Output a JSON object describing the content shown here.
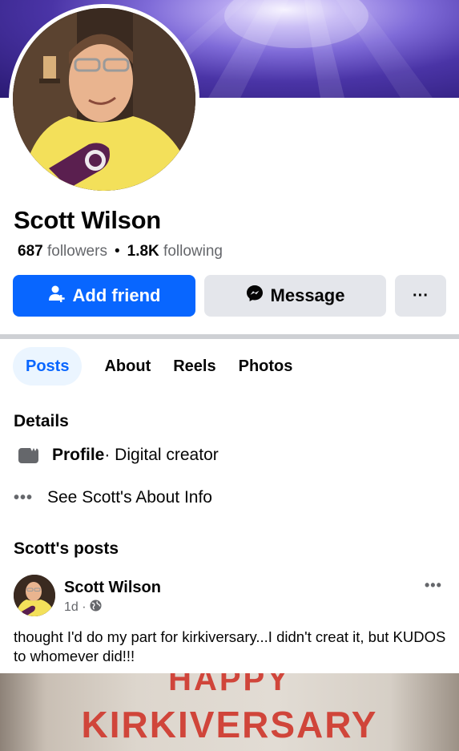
{
  "profile": {
    "name": "Scott Wilson",
    "followers_count": "687",
    "followers_label": "followers",
    "following_count": "1.8K",
    "following_label": "following"
  },
  "actions": {
    "add_friend_label": "Add friend",
    "message_label": "Message",
    "more_label": "···"
  },
  "tabs": [
    {
      "label": "Posts",
      "active": true
    },
    {
      "label": "About",
      "active": false
    },
    {
      "label": "Reels",
      "active": false
    },
    {
      "label": "Photos",
      "active": false
    }
  ],
  "details": {
    "title": "Details",
    "profile_label": "Profile",
    "profile_value": " · Digital creator",
    "see_about": "See Scott's About Info"
  },
  "posts": {
    "title": "Scott's posts",
    "items": [
      {
        "author": "Scott Wilson",
        "time": "1d ·",
        "text": "thought I'd do my part for kirkiversary...I didn't creat it, but KUDOS to whomever did!!!",
        "image_line1": "HAPPY",
        "image_line2": "KIRKIVERSARY"
      }
    ]
  },
  "icons": {
    "add_friend": "add-person-icon",
    "message": "messenger-icon",
    "profile": "profile-card-icon",
    "see_more": "more-dots-icon",
    "audience": "globe-icon"
  },
  "colors": {
    "primary_blue": "#0866ff",
    "button_gray": "#e4e6eb",
    "tab_active_bg": "#ebf5ff",
    "secondary_text": "#65676b",
    "image_text": "#d0453a"
  }
}
